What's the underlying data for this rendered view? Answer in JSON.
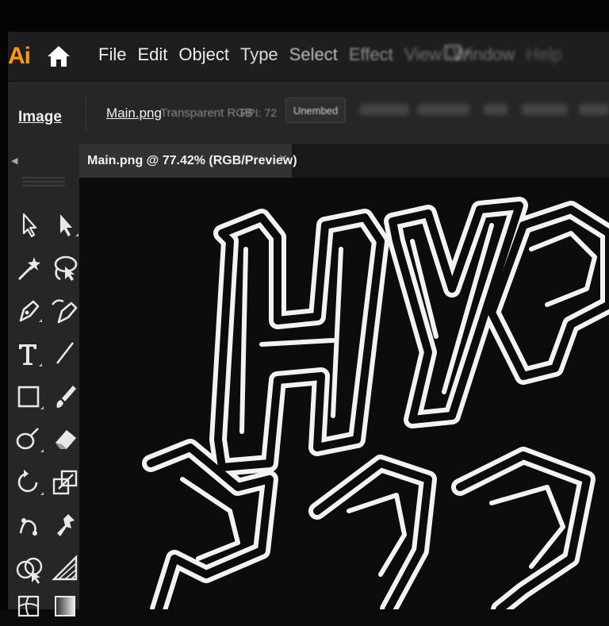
{
  "app": {
    "logo_text": "Ai",
    "logo_color": "#ff9a00"
  },
  "menubar": {
    "items": [
      "File",
      "Edit",
      "Object",
      "Type",
      "Select",
      "Effect",
      "View",
      "Window",
      "Help"
    ]
  },
  "control_bar": {
    "selection_label": "Image",
    "file_name": "Main.png",
    "color_mode": "Transparent RGB",
    "ppi": "PPI: 72",
    "embed_button": "Unembed"
  },
  "document": {
    "tab_title": "Main.png @ 77.42% (RGB/Preview)",
    "close_glyph": "×"
  },
  "tools": [
    "selection-tool",
    "direct-selection-tool",
    "magic-wand-tool",
    "lasso-tool",
    "pen-tool",
    "curvature-tool",
    "type-tool",
    "line-segment-tool",
    "rectangle-tool",
    "paintbrush-tool",
    "shaper-tool",
    "eraser-tool",
    "rotate-tool",
    "scale-tool",
    "puppet-warp-tool",
    "free-transform-tool",
    "shape-builder-tool",
    "perspective-grid-tool",
    "mesh-tool",
    "gradient-tool"
  ],
  "artwork": {
    "description_icon": "graffiti-lettering-artwork"
  }
}
